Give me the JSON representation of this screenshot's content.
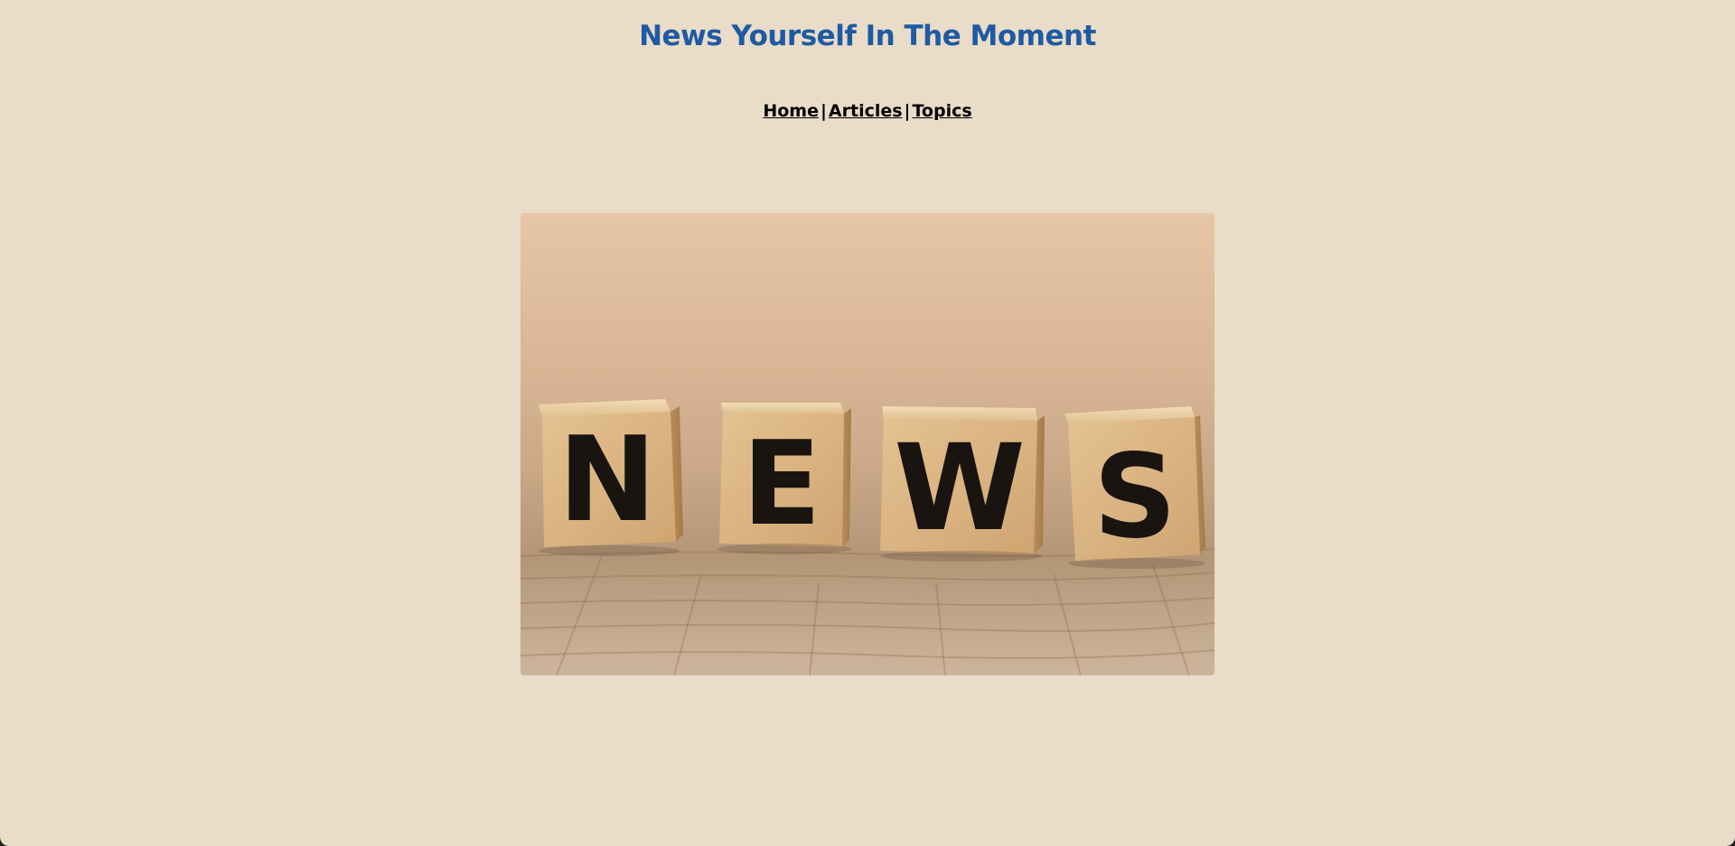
{
  "header": {
    "title": "News Yourself In The Moment"
  },
  "nav": {
    "items": [
      {
        "label": "Home"
      },
      {
        "label": "Articles"
      },
      {
        "label": "Topics"
      }
    ],
    "separator": "|"
  },
  "hero_image": {
    "alt": "NEWS",
    "blocks": [
      "N",
      "E",
      "W",
      "S"
    ]
  },
  "colors": {
    "background": "#e9dcc8",
    "title": "#1f5aa3",
    "nav_text": "#000000"
  }
}
